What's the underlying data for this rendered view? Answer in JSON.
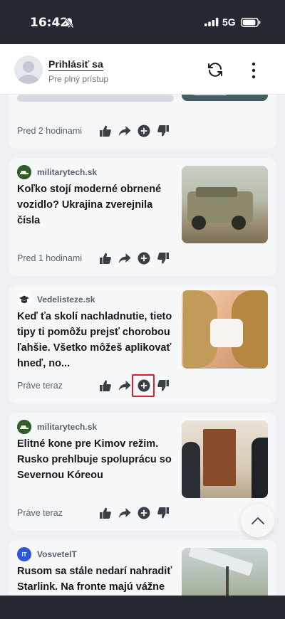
{
  "status_bar": {
    "time": "16:42",
    "network": "5G",
    "icons": [
      "bell-muted-icon",
      "signal-icon",
      "battery-icon"
    ]
  },
  "header": {
    "login_label": "Prihlásiť sa",
    "login_subtitle": "Pre plný prístup",
    "icons": [
      "avatar-placeholder",
      "refresh-icon",
      "more-vertical-icon"
    ]
  },
  "feed": {
    "cards": [
      {
        "source": "",
        "headline": "",
        "time": "Pred 2 hodinami"
      },
      {
        "source": "militarytech.sk",
        "headline": "Koľko stojí moderné obrnené vozidlo? Ukrajina zverejnila čísla",
        "time": "Pred 1 hodinami"
      },
      {
        "source": "Vedelisteze.sk",
        "headline": "Keď ťa skolí nachladnutie, tieto tipy ti pomôžu prejsť chorobou ľahšie. Všetko môžeš aplikovať hneď, no...",
        "time": "Práve teraz"
      },
      {
        "source": "militarytech.sk",
        "headline": "Elitné kone pre Kimov režim. Rusko prehlbuje spoluprácu so Severnou Kóreou",
        "time": "Práve teraz"
      },
      {
        "source": "VosveteIT",
        "source_icon_text": "IT",
        "headline": "Rusom sa stále nedarí nahradiť Starlink. Na fronte majú vážne",
        "time": ""
      }
    ],
    "action_icons": [
      "thumbs-up-icon",
      "share-icon",
      "add-circle-icon",
      "thumbs-down-icon"
    ]
  },
  "colors": {
    "status_bar_bg": "#252a32",
    "card_bg": "#f6f7f9",
    "highlight": "#d9202b",
    "militarytech_icon": "#2e5e2c",
    "vosveteit_icon": "#2f56d8"
  }
}
